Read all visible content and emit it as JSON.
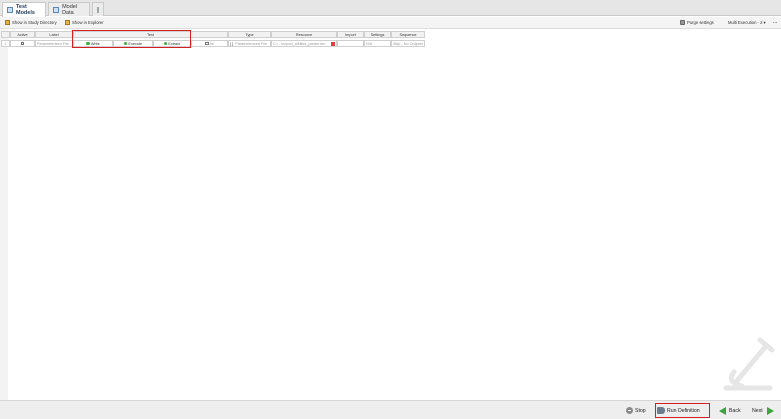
{
  "tabs": [
    {
      "label": "Test Models",
      "icon": "grid-icon",
      "active": true
    },
    {
      "label": "Model Data",
      "icon": "grid-icon",
      "active": false
    },
    {
      "label": "",
      "icon": "table-icon",
      "active": false
    }
  ],
  "toolbar": {
    "show_study_dir": "Show in Study Directory",
    "show_explorer": "Show in Explorer",
    "purge_settings": "Purge settings",
    "multi_execution": "Multi Execution - 2",
    "more": "..."
  },
  "table": {
    "headers": {
      "active": "Active",
      "label": "Label",
      "test": "Test",
      "type": "Type",
      "resource": "Resource",
      "import": "Import",
      "settings": "Settings",
      "sequence": "Sequence"
    },
    "row": {
      "number": "1",
      "label": "Parameterized File",
      "write": "Write",
      "execute": "Execute",
      "extract": "Extract",
      "all": "All",
      "type_bracket": "[ ]",
      "type": "Parameterized File",
      "resource": "C:\\...\\export_all\\files_param.bin",
      "import": "",
      "settings": "N/A",
      "sequence": "Skip - No Outputs"
    }
  },
  "bottom": {
    "stop": "Stop",
    "run_definition": "Run Definition",
    "back": "Back",
    "next": "Next"
  },
  "colors": {
    "highlight": "#d42020",
    "accent_green": "#3ba43b"
  }
}
